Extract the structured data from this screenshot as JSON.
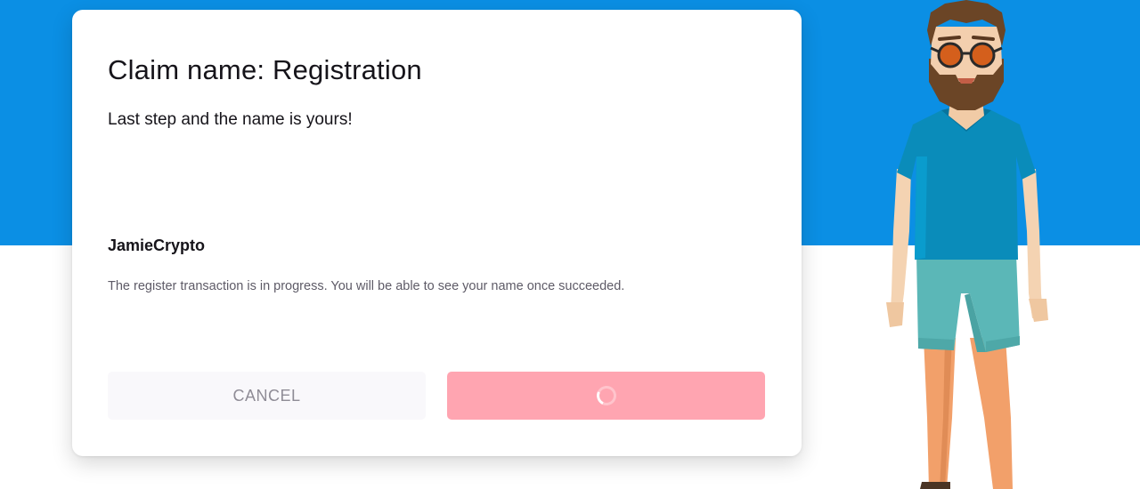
{
  "modal": {
    "title": "Claim name: Registration",
    "subtitle": "Last step and the name is yours!",
    "name": "JamieCrypto",
    "status_message": "The register transaction is in progress. You will be able to see your name once succeeded.",
    "cancel_label": "CANCEL",
    "confirm_state": "loading"
  },
  "icons": {
    "confirm": "loading-spinner-icon"
  },
  "colors": {
    "background_band": "#0b8fe4",
    "page_background": "#ffffff",
    "modal_background": "#ffffff",
    "title_text": "#16141a",
    "secondary_text": "#5e5b67",
    "cancel_button_bg": "#f9f8fb",
    "cancel_button_text": "#8f8c96",
    "confirm_button_bg": "#ffa5b1"
  }
}
